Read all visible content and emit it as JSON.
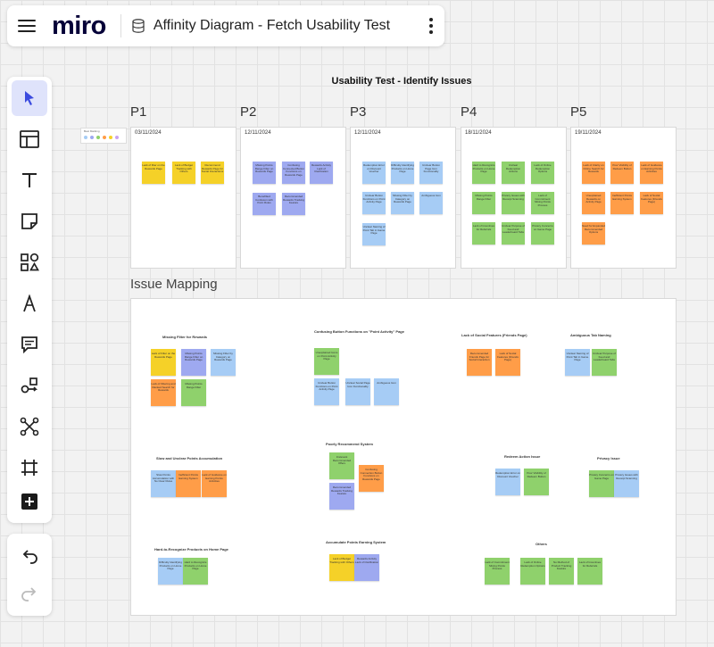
{
  "topbar": {
    "logo": "miro",
    "board_title": "Affinity Diagram - Fetch Usability Test"
  },
  "toolbar": {
    "tools": [
      "select-icon",
      "templates-icon",
      "text-icon",
      "sticky-note-icon",
      "shapes-icon",
      "pen-icon",
      "comment-icon",
      "connection-line-icon",
      "mind-map-icon",
      "frame-icon",
      "add-icon"
    ]
  },
  "canvas": {
    "title": "Usability Test -  Identify Issues",
    "legend_title": "Best Marking",
    "participants": [
      {
        "label": "P1",
        "date": "03/11/2024"
      },
      {
        "label": "P2",
        "date": "12/11/2024"
      },
      {
        "label": "P3",
        "date": "12/11/2024"
      },
      {
        "label": "P4",
        "date": "18/11/2024"
      },
      {
        "label": "P5",
        "date": "19/11/2024"
      }
    ],
    "stickies": [
      [
        "Lack of filter on the Rewards Page",
        "Lack of Budget Tracking with Others",
        "Recommend Rewards Page for Social Interactions"
      ],
      [
        "Missing Points Range Filter on Rewards Page",
        "Confusing Connected Button Functions on Rewards Page",
        "Rewards Activity Lack of Clarification",
        "Benefitted Confusion with Point Rules",
        "Recommended Rewards Tracking Feature"
      ],
      [
        "Redemption Error on Discount Voucher",
        "Difficulty Identifying Products on Home Page",
        "Unclear Button Page Icon Functionality",
        "Unclear Button Functions on Point Activity Page",
        "Missing Filter by Category on Rewards Page",
        "Ambiguous Icon",
        "Unclear Naming of Point Tab in Game Page"
      ],
      [
        "Hard to Recognize Products on Home Page",
        "Unclear Redemption Actions",
        "Lack of Online Redemption Options",
        "Missing Points Range Filter",
        "Privacy Issues with Receipt Scanning",
        "Lack of Commitment Mixing Points Process",
        "Lack of Incentives for Referrals",
        "Unclear Purpose of Feed and Leaderboard Tabs",
        "Privacy Concerns on Game Page"
      ],
      [
        "Lack of Clarity on Online Search for Rewards",
        "Poor Visibility of Redeem Button",
        "Lack of Guidance on Earning Points Activities",
        "Unexplained Rewards on Activity Page",
        "Inefficient Points Earning System",
        "Lack of Social Features (Friends Page)",
        "Need for Expanded Recommended Options"
      ]
    ]
  },
  "mapping": {
    "title": "Issue Mapping",
    "groups": [
      {
        "title": "Missing Filter for Rewards",
        "notes": [
          "Lack of Filter on the Rewards Page",
          "Missing Points Range Filter on Rewards Page",
          "Missing Filter by Category on Rewards Page",
          "Lack of Filtering and Ranked Search for Rewards",
          "Missing Points Range Filter"
        ]
      },
      {
        "title": "Confusing Button Functions on \"Point Activity\" Page",
        "notes": [
          "Unexplained Icons on Point Activity Page",
          "Unclear Button Functions on Point Activity Page",
          "Unclear Social Page Icon Functionality",
          "Ambiguous Icon",
          "Confusing Button Functions on Point Activity Page"
        ]
      },
      {
        "title": "Lack of Social Features (Friends Page)",
        "notes": [
          "Recommended Friends Page for Social Interaction",
          "Lack of Social Features (Friends Page)"
        ]
      },
      {
        "title": "Ambiguous Tab Naming",
        "notes": [
          "Unclear Naming of Point Tab in Game Page",
          "Unclear Purpose of Feed and Leaderboard Tabs"
        ]
      },
      {
        "title": "Slow and Unclear Points Accumulation",
        "notes": [
          "Slow Points Accumulation with No Clear Rules",
          "Inefficient Points Earning System",
          "Lack of Guidance on Earning Points Activities"
        ]
      },
      {
        "title": "Poorly Recommend System",
        "notes": [
          "Irrelevant Recommended Offers",
          "Recommended Rewards Tracking Feature",
          "Confusing Connection Button Functions on Rewards Page"
        ]
      },
      {
        "title": "Redeem Action Issue",
        "notes": [
          "Redemption Error on Discount Voucher",
          "Poor Visibility of Redeem Button"
        ]
      },
      {
        "title": "Privacy Issue",
        "notes": [
          "Privacy Concerns on Game Page",
          "Privacy Issues with Receipt Scanning"
        ]
      },
      {
        "title": "Hard-to-Recognize Products on Home Page",
        "notes": [
          "Difficulty Identifying Products on Home Page",
          "Hard to Recognize Products on Home Page"
        ]
      },
      {
        "title": "Accumulate Points Earning System",
        "notes": [
          "Lack of Budget Tracking with Others",
          "Rewards Activity Lack of Clarification"
        ]
      },
      {
        "title": "Others",
        "notes": [
          "Lack of Commitment Mixing Points Process",
          "Lack of Online Redemption Options",
          "No Method of Product Tracking Feature",
          "Lack of Incentives for Referrals"
        ]
      }
    ]
  },
  "colors": {
    "yellow": "#f5d128",
    "purple": "#9ea9f0",
    "blue": "#a6ccf5",
    "green": "#8fd16c",
    "orange": "#ff9d48",
    "accent": "#4262ff"
  }
}
